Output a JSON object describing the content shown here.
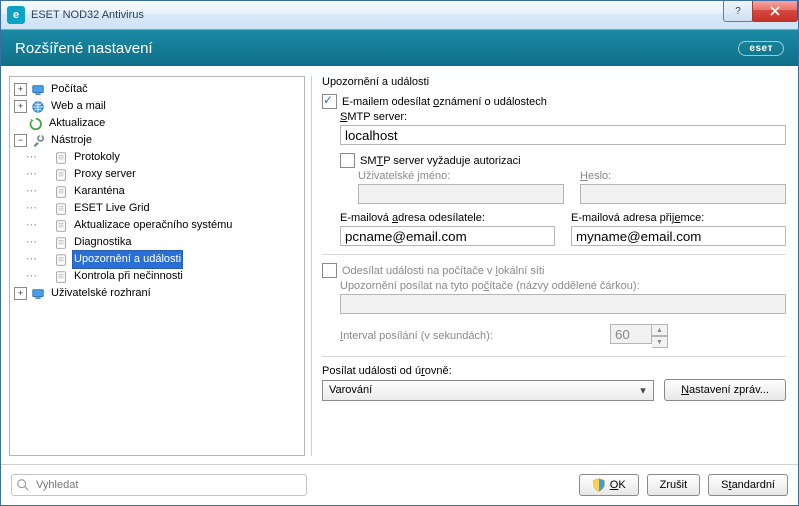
{
  "titlebar": {
    "app": "ESET NOD32 Antivirus"
  },
  "header": {
    "title": "Rozšířené nastavení",
    "logo": "eseт"
  },
  "tree": [
    {
      "indent": 0,
      "toggle": "+",
      "icon": "computer",
      "label": "Počítač"
    },
    {
      "indent": 0,
      "toggle": "+",
      "icon": "globe",
      "label": "Web a mail"
    },
    {
      "indent": 0,
      "toggle": "",
      "icon": "refresh",
      "label": "Aktualizace"
    },
    {
      "indent": 0,
      "toggle": "-",
      "icon": "tools",
      "label": "Nástroje"
    },
    {
      "indent": 1,
      "toggle": "",
      "icon": "doc",
      "label": "Protokoly"
    },
    {
      "indent": 1,
      "toggle": "",
      "icon": "doc",
      "label": "Proxy server"
    },
    {
      "indent": 1,
      "toggle": "",
      "icon": "doc",
      "label": "Karanténa"
    },
    {
      "indent": 1,
      "toggle": "",
      "icon": "doc",
      "label": "ESET Live Grid"
    },
    {
      "indent": 1,
      "toggle": "",
      "icon": "doc",
      "label": "Aktualizace operačního systému"
    },
    {
      "indent": 1,
      "toggle": "",
      "icon": "doc",
      "label": "Diagnostika"
    },
    {
      "indent": 1,
      "toggle": "",
      "icon": "doc",
      "label": "Upozornění a události",
      "selected": true
    },
    {
      "indent": 1,
      "toggle": "",
      "icon": "doc",
      "label": "Kontrola při nečinnosti"
    },
    {
      "indent": 0,
      "toggle": "+",
      "icon": "computer",
      "label": "Uživatelské rozhraní"
    }
  ],
  "panel": {
    "section": "Upozornění a události",
    "emailCb": {
      "checked": true,
      "pre": "E-mailem odesílat ",
      "u": "o",
      "post": "známení o událostech"
    },
    "smtpLabel": {
      "pre": "",
      "u": "S",
      "post": "MTP server:"
    },
    "smtpValue": "localhost",
    "authCb": {
      "checked": false,
      "pre": "SM",
      "u": "T",
      "post": "P server vyžaduje autorizaci"
    },
    "userLabel": {
      "pre": "Uživatelské ",
      "u": "j",
      "post": "méno:"
    },
    "userValue": "",
    "passLabel": {
      "pre": "",
      "u": "H",
      "post": "eslo:"
    },
    "passValue": "",
    "senderLabel": {
      "pre": "E-mailová ",
      "u": "a",
      "post": "dresa odesílatele:"
    },
    "senderValue": "pcname@email.com",
    "recipLabel": {
      "pre": "E-mailová adresa přij",
      "u": "e",
      "post": "mce:"
    },
    "recipValue": "myname@email.com",
    "lanCb": {
      "checked": false,
      "pre": "Odesílat události na počítače v ",
      "u": "l",
      "post": "okální síti"
    },
    "lanTargetsLabel": {
      "pre": "Upozornění posílat na tyto po",
      "u": "č",
      "post": "ítače (názvy oddělené čárkou):"
    },
    "lanTargetsValue": "",
    "intervalLabel": {
      "pre": "",
      "u": "I",
      "post": "nterval posílání (v sekundách):"
    },
    "intervalValue": "60",
    "levelLabel": {
      "pre": "Posílat události od ú",
      "u": "r",
      "post": "ovně:"
    },
    "levelValue": "Varování",
    "msgBtn": {
      "pre": "",
      "u": "N",
      "post": "astavení zpráv..."
    }
  },
  "footer": {
    "searchPlaceholder": "Vyhledat",
    "ok": {
      "pre": "",
      "u": "O",
      "post": "K"
    },
    "cancel": "Zrušit",
    "default": {
      "pre": "S",
      "u": "t",
      "post": "andardní"
    }
  }
}
